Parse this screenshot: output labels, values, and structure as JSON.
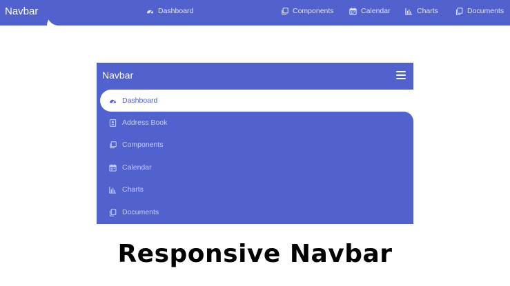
{
  "topbar": {
    "brand": "Navbar",
    "items": [
      {
        "label": "Dashboard",
        "icon": "dashboard-icon"
      },
      {
        "label": "Components",
        "icon": "components-icon"
      },
      {
        "label": "Calendar",
        "icon": "calendar-icon"
      },
      {
        "label": "Charts",
        "icon": "chart-icon"
      },
      {
        "label": "Documents",
        "icon": "documents-icon"
      }
    ]
  },
  "mobile": {
    "brand": "Navbar",
    "menu_icon": "hamburger-icon",
    "items": [
      {
        "label": "Dashboard",
        "icon": "dashboard-icon",
        "active": true
      },
      {
        "label": "Address Book",
        "icon": "address-book-icon"
      },
      {
        "label": "Components",
        "icon": "components-icon"
      },
      {
        "label": "Calendar",
        "icon": "calendar-icon"
      },
      {
        "label": "Charts",
        "icon": "chart-icon"
      },
      {
        "label": "Documents",
        "icon": "documents-icon"
      }
    ]
  },
  "caption": "Responsive Navbar",
  "colors": {
    "accent": "#5161ce",
    "text_light": "#dfe3ff",
    "background": "#ffffff"
  }
}
